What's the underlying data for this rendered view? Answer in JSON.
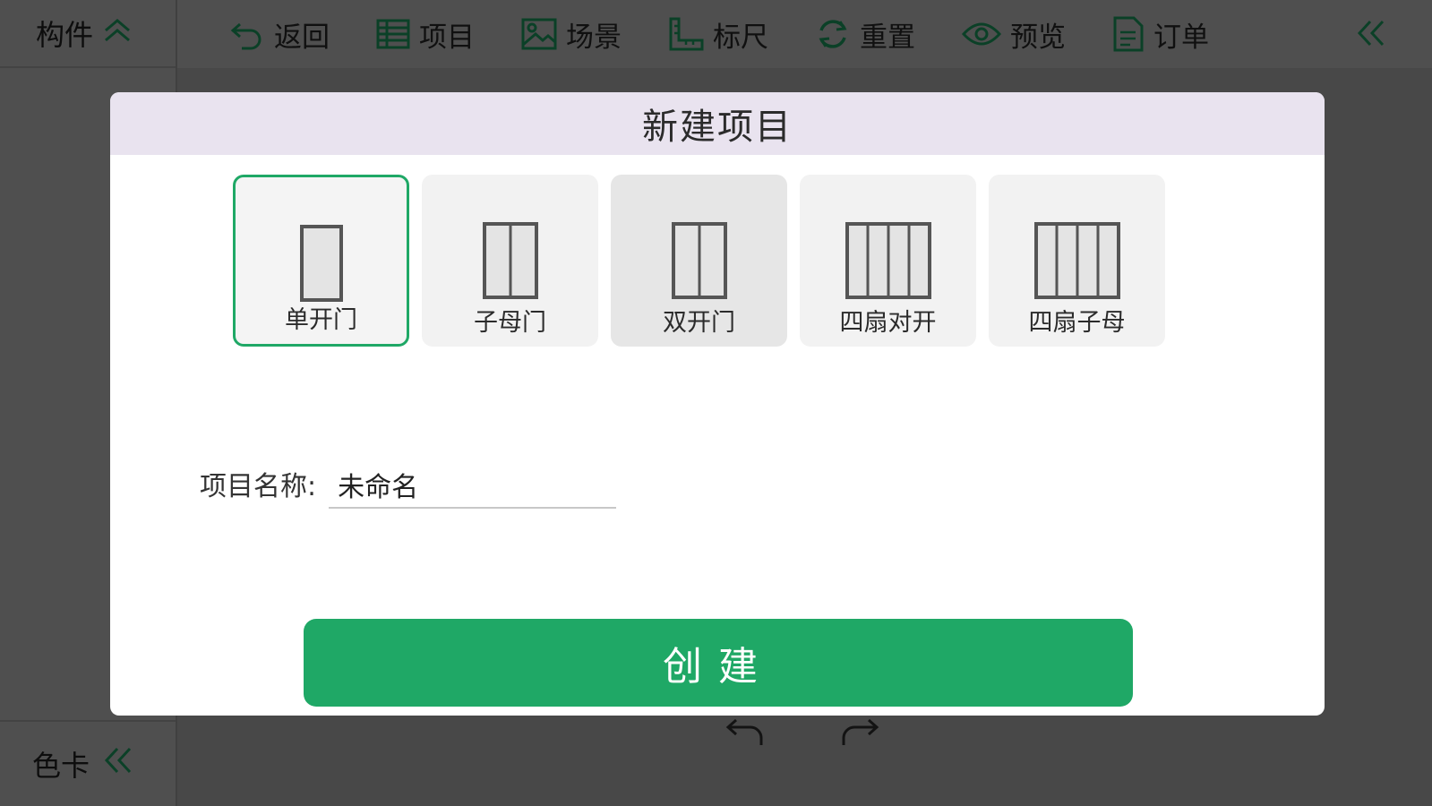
{
  "sidebar": {
    "header_label": "构件",
    "header_icon": "double-chevron-up-icon",
    "footer_label": "色卡",
    "footer_icon": "double-chevron-left-icon"
  },
  "toolbar": {
    "items": [
      {
        "label": "返回",
        "icon": "undo-arrow-icon"
      },
      {
        "label": "项目",
        "icon": "list-icon"
      },
      {
        "label": "场景",
        "icon": "image-icon"
      },
      {
        "label": "标尺",
        "icon": "ruler-icon"
      },
      {
        "label": "重置",
        "icon": "refresh-icon"
      },
      {
        "label": "预览",
        "icon": "eye-icon"
      },
      {
        "label": "订单",
        "icon": "document-icon"
      }
    ],
    "collapse_icon": "double-chevron-left-icon"
  },
  "dialog": {
    "title": "新建项目",
    "door_types": [
      {
        "label": "单开门",
        "panels": 1,
        "state": "selected"
      },
      {
        "label": "子母门",
        "panels": 2,
        "state": "normal"
      },
      {
        "label": "双开门",
        "panels": 2,
        "state": "hover"
      },
      {
        "label": "四扇对开",
        "panels": 4,
        "state": "normal"
      },
      {
        "label": "四扇子母",
        "panels": 4,
        "state": "normal"
      }
    ],
    "name_label": "项目名称:",
    "name_value": "未命名",
    "create_label": "创建"
  },
  "colors": {
    "accent": "#1fa866",
    "dialog_header_bg": "#e9e3ef",
    "overlay": "rgba(0,0,0,0.62)"
  }
}
